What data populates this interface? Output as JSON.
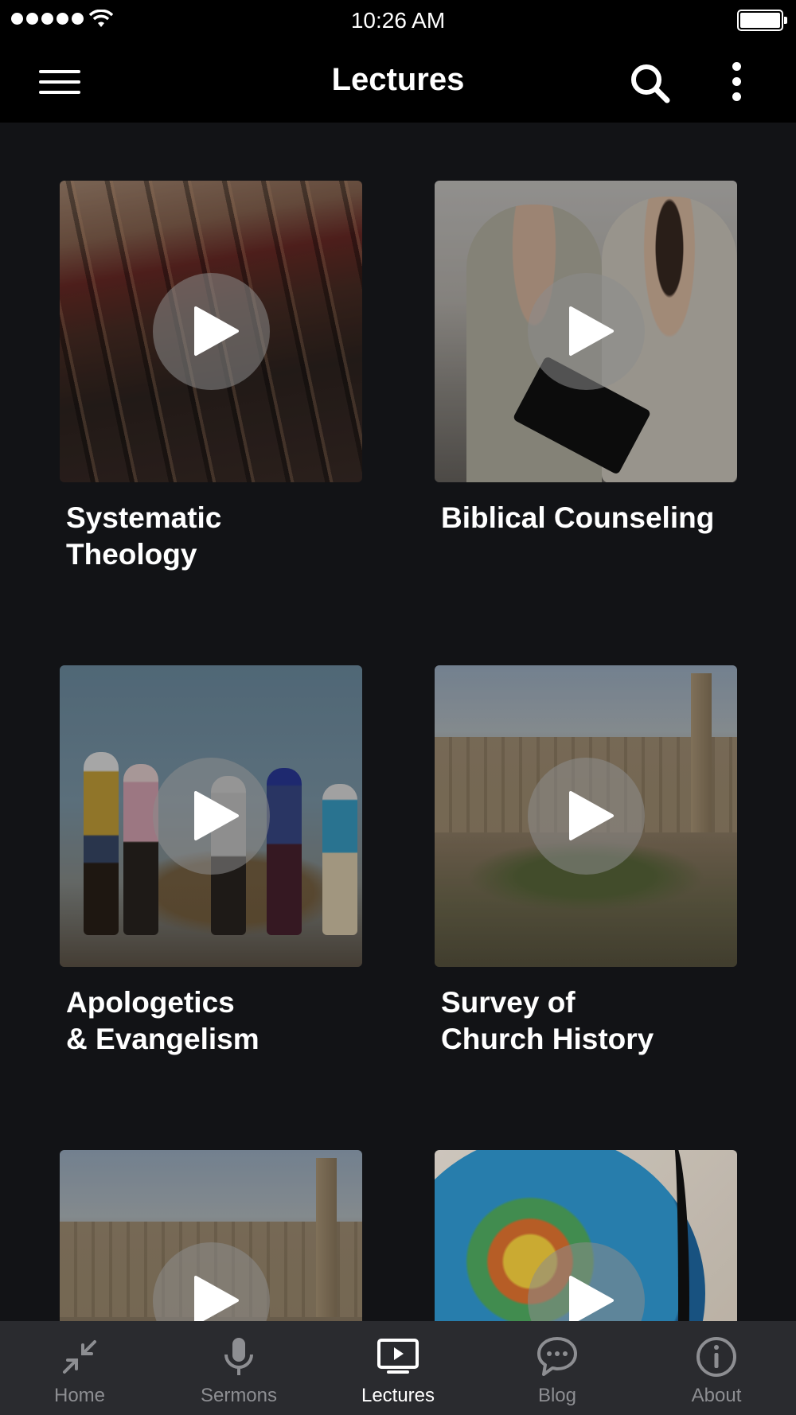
{
  "status_bar": {
    "time": "10:26 AM"
  },
  "app_bar": {
    "title": "Lectures"
  },
  "lectures": [
    {
      "title": "Systematic\nTheology"
    },
    {
      "title": "Biblical Counseling"
    },
    {
      "title": "Apologetics\n& Evangelism"
    },
    {
      "title": "Survey of\nChurch History"
    }
  ],
  "tabs": [
    {
      "label": "Home",
      "icon": "collapse-arrows-icon",
      "active": false
    },
    {
      "label": "Sermons",
      "icon": "microphone-icon",
      "active": false
    },
    {
      "label": "Lectures",
      "icon": "tv-play-icon",
      "active": true
    },
    {
      "label": "Blog",
      "icon": "chat-bubble-icon",
      "active": false
    },
    {
      "label": "About",
      "icon": "info-icon",
      "active": false
    }
  ],
  "colors": {
    "background": "#121316",
    "bar": "#000000",
    "tab_bar": "#2a2b2f",
    "tab_inactive": "#8d8e92",
    "tab_active": "#ffffff"
  }
}
